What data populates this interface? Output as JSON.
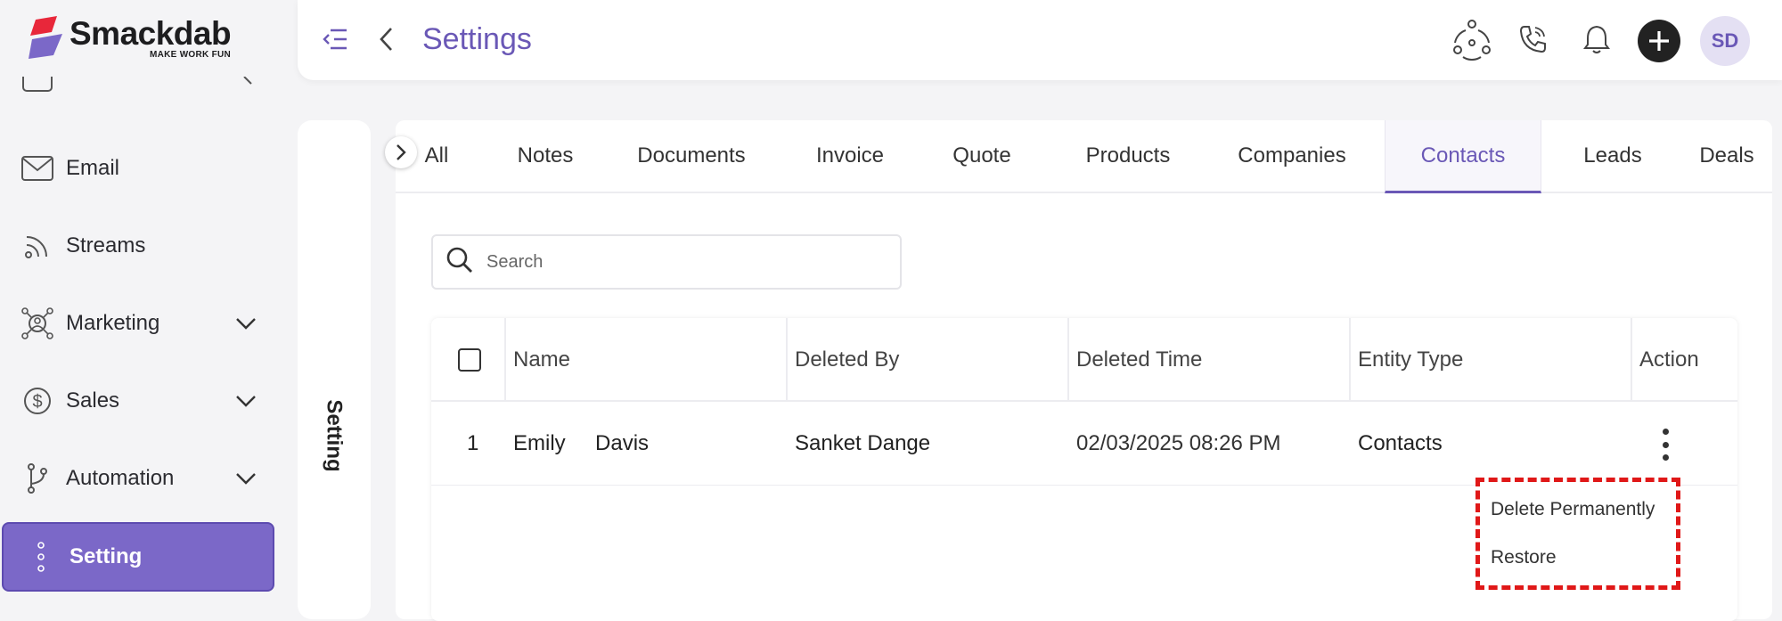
{
  "brand": {
    "name": "Smackdab",
    "tagline": "MAKE WORK FUN",
    "colors": {
      "accent": "#7b68c8",
      "accent_text": "#6a58b6",
      "logo_red": "#e8273a"
    }
  },
  "sidebar": {
    "items": [
      {
        "label": "Email",
        "icon": "mail-icon",
        "has_chevron": false
      },
      {
        "label": "Streams",
        "icon": "rss-icon",
        "has_chevron": false
      },
      {
        "label": "Marketing",
        "icon": "marketing-icon",
        "has_chevron": true
      },
      {
        "label": "Sales",
        "icon": "dollar-icon",
        "has_chevron": true
      },
      {
        "label": "Automation",
        "icon": "branch-icon",
        "has_chevron": true
      },
      {
        "label": "Setting",
        "icon": "vertical-dots-icon",
        "has_chevron": false,
        "active": true
      }
    ]
  },
  "header": {
    "title": "Settings",
    "avatar_initials": "SD"
  },
  "setting_panel": {
    "label": "Setting"
  },
  "tabs": [
    {
      "label": "All"
    },
    {
      "label": "Notes"
    },
    {
      "label": "Documents"
    },
    {
      "label": "Invoice"
    },
    {
      "label": "Quote"
    },
    {
      "label": "Products"
    },
    {
      "label": "Companies"
    },
    {
      "label": "Contacts",
      "active": true
    },
    {
      "label": "Leads"
    },
    {
      "label": "Deals"
    }
  ],
  "search": {
    "placeholder": "Search",
    "value": ""
  },
  "table": {
    "columns": [
      "Name",
      "Deleted By",
      "Deleted Time",
      "Entity Type",
      "Action"
    ],
    "rows": [
      {
        "index": "1",
        "first_name": "Emily",
        "last_name": "Davis",
        "deleted_by": "Sanket Dange",
        "deleted_time": "02/03/2025 08:26 PM",
        "entity_type": "Contacts"
      }
    ]
  },
  "action_menu": {
    "items": [
      "Delete Permanently",
      "Restore"
    ]
  }
}
